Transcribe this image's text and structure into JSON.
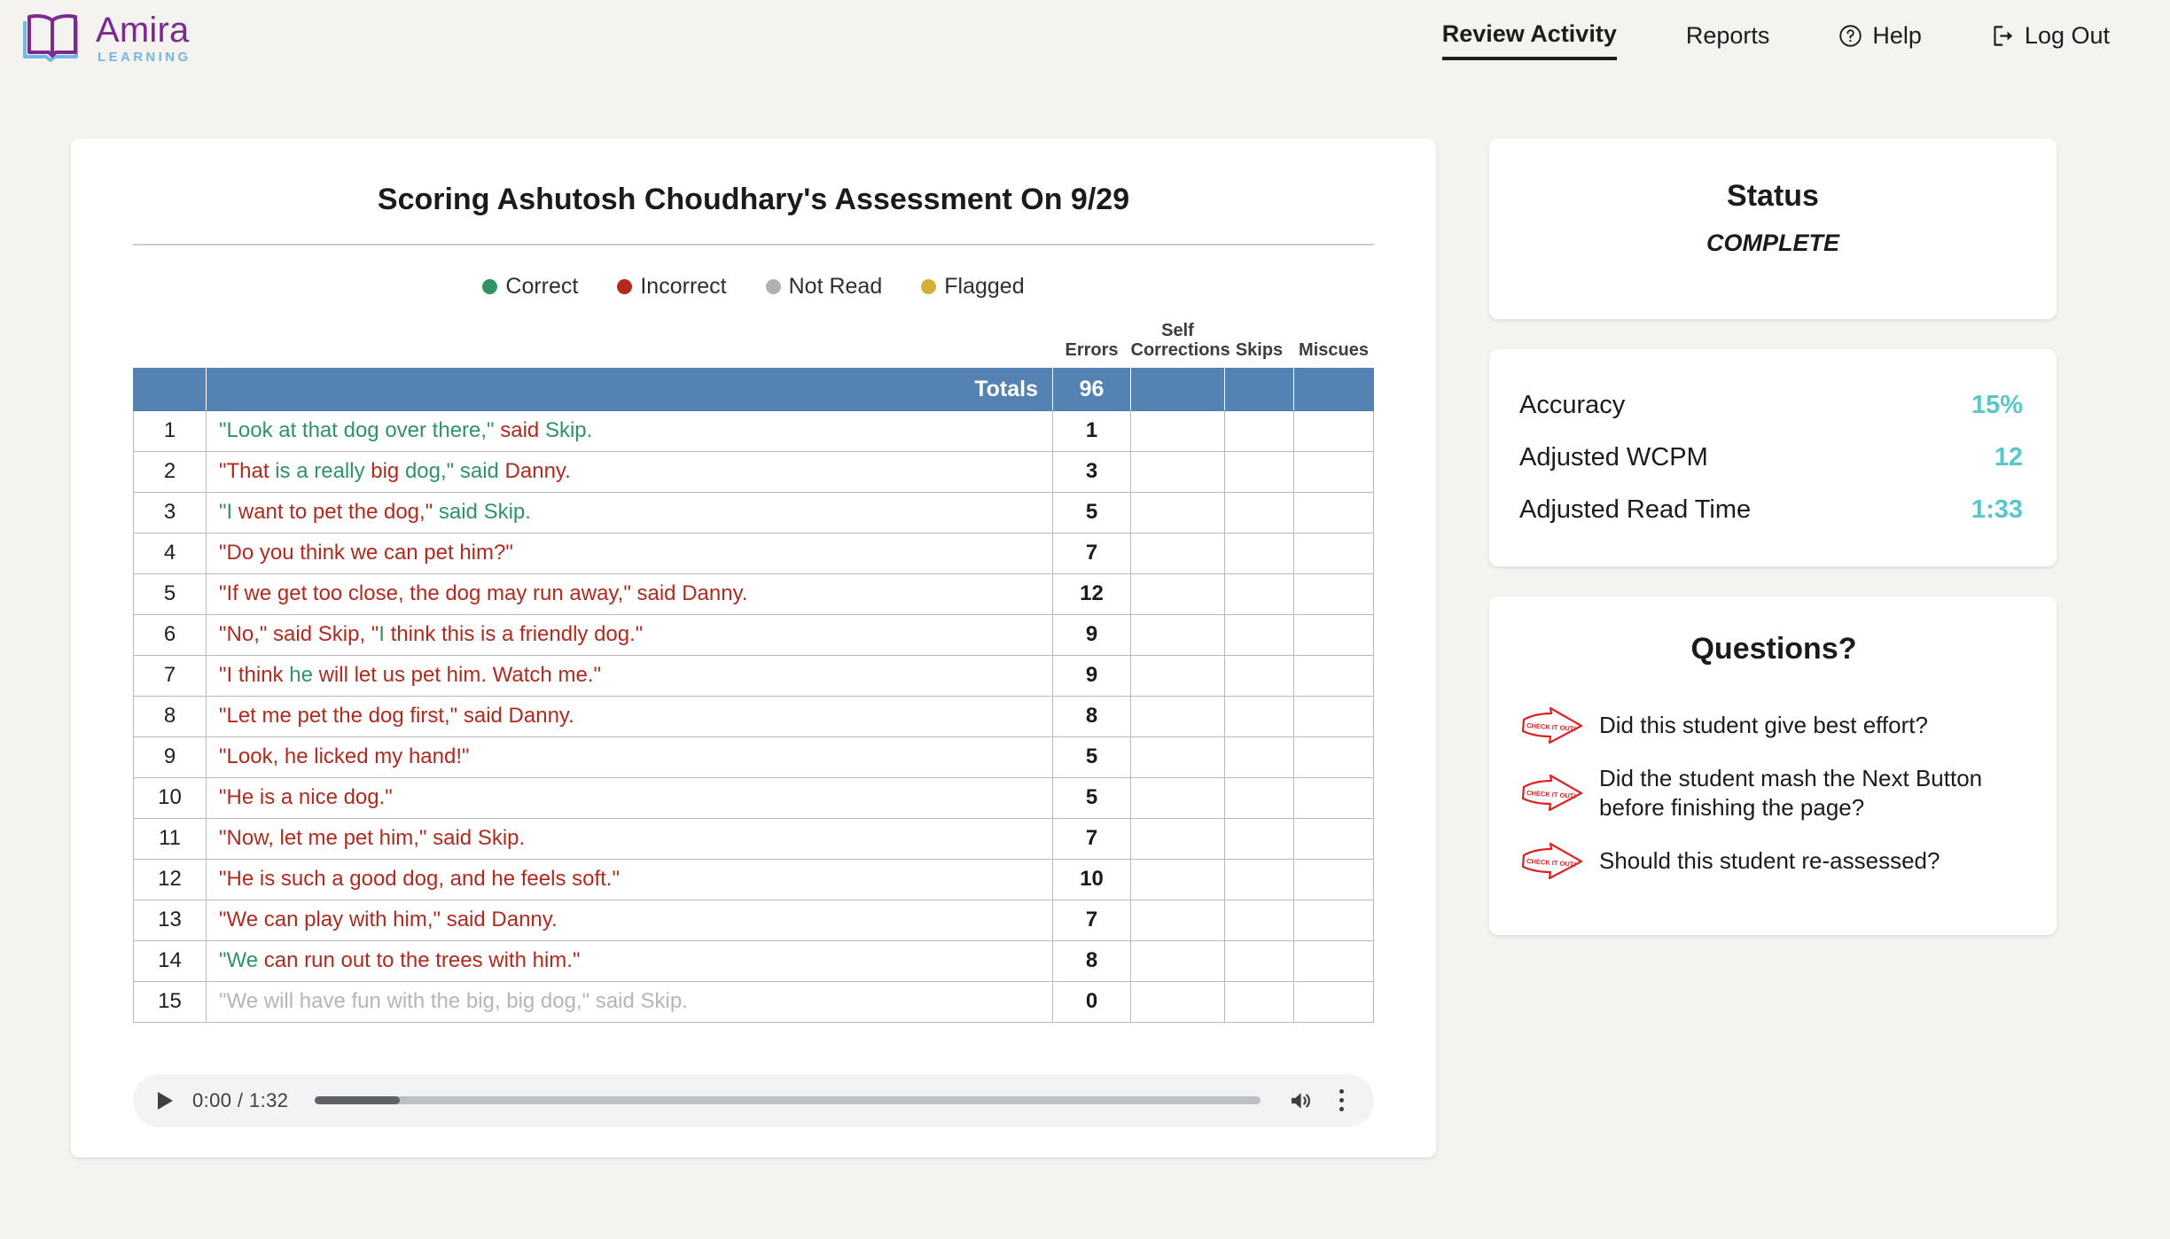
{
  "brand": {
    "name": "Amira",
    "sub": "LEARNING",
    "logo_icon": "open-book-icon"
  },
  "nav": {
    "items": [
      {
        "label": "Review Activity",
        "icon": null,
        "active": true
      },
      {
        "label": "Reports",
        "icon": null,
        "active": false
      },
      {
        "label": "Help",
        "icon": "question-circle-icon",
        "active": false
      },
      {
        "label": "Log Out",
        "icon": "sign-out-icon",
        "active": false
      }
    ]
  },
  "main": {
    "title": "Scoring Ashutosh Choudhary's Assessment On 9/29",
    "legend": [
      {
        "label": "Correct",
        "color": "#2e9464"
      },
      {
        "label": "Incorrect",
        "color": "#b22a1e"
      },
      {
        "label": "Not Read",
        "color": "#b0b0b0"
      },
      {
        "label": "Flagged",
        "color": "#d4af37"
      }
    ],
    "table": {
      "headers": {
        "num": "",
        "text": "",
        "errors": "Errors",
        "self_corrections": "Self Corrections",
        "skips": "Skips",
        "miscues": "Miscues"
      },
      "totals": {
        "label": "Totals",
        "errors": "96",
        "self_corrections": "",
        "skips": "",
        "miscues": ""
      },
      "rows": [
        {
          "num": "1",
          "errors": "1",
          "self_corrections": "",
          "skips": "",
          "miscues": "",
          "segments": [
            {
              "t": "\"Look at that dog over there,\" ",
              "s": "correct"
            },
            {
              "t": "said",
              "s": "incorrect"
            },
            {
              "t": " Skip.",
              "s": "correct"
            }
          ]
        },
        {
          "num": "2",
          "errors": "3",
          "self_corrections": "",
          "skips": "",
          "miscues": "",
          "segments": [
            {
              "t": "\"That",
              "s": "incorrect"
            },
            {
              "t": " is a really ",
              "s": "correct"
            },
            {
              "t": "big",
              "s": "incorrect"
            },
            {
              "t": " dog,\" said ",
              "s": "correct"
            },
            {
              "t": "Danny.",
              "s": "incorrect"
            }
          ]
        },
        {
          "num": "3",
          "errors": "5",
          "self_corrections": "",
          "skips": "",
          "miscues": "",
          "segments": [
            {
              "t": "\"I",
              "s": "correct"
            },
            {
              "t": " want to pet the dog,\" ",
              "s": "incorrect"
            },
            {
              "t": "said Skip.",
              "s": "correct"
            }
          ]
        },
        {
          "num": "4",
          "errors": "7",
          "self_corrections": "",
          "skips": "",
          "miscues": "",
          "segments": [
            {
              "t": "\"Do you think we can pet him?\"",
              "s": "incorrect"
            }
          ]
        },
        {
          "num": "5",
          "errors": "12",
          "self_corrections": "",
          "skips": "",
          "miscues": "",
          "segments": [
            {
              "t": "\"If we get too close, the dog may run away,\" said Danny.",
              "s": "incorrect"
            }
          ]
        },
        {
          "num": "6",
          "errors": "9",
          "self_corrections": "",
          "skips": "",
          "miscues": "",
          "segments": [
            {
              "t": "\"No,\" said Skip, \"",
              "s": "incorrect"
            },
            {
              "t": "I",
              "s": "correct"
            },
            {
              "t": " think this is a friendly dog.\"",
              "s": "incorrect"
            }
          ]
        },
        {
          "num": "7",
          "errors": "9",
          "self_corrections": "",
          "skips": "",
          "miscues": "",
          "segments": [
            {
              "t": "\"I think ",
              "s": "incorrect"
            },
            {
              "t": "he",
              "s": "correct"
            },
            {
              "t": " will let us pet him. Watch me.\"",
              "s": "incorrect"
            }
          ]
        },
        {
          "num": "8",
          "errors": "8",
          "self_corrections": "",
          "skips": "",
          "miscues": "",
          "segments": [
            {
              "t": "\"Let me pet the dog first,\" said Danny.",
              "s": "incorrect"
            }
          ]
        },
        {
          "num": "9",
          "errors": "5",
          "self_corrections": "",
          "skips": "",
          "miscues": "",
          "segments": [
            {
              "t": "\"Look, he licked my hand!\"",
              "s": "incorrect"
            }
          ]
        },
        {
          "num": "10",
          "errors": "5",
          "self_corrections": "",
          "skips": "",
          "miscues": "",
          "segments": [
            {
              "t": "\"He is a nice dog.\"",
              "s": "incorrect"
            }
          ]
        },
        {
          "num": "11",
          "errors": "7",
          "self_corrections": "",
          "skips": "",
          "miscues": "",
          "segments": [
            {
              "t": "\"Now, let me pet him,\" said Skip.",
              "s": "incorrect"
            }
          ]
        },
        {
          "num": "12",
          "errors": "10",
          "self_corrections": "",
          "skips": "",
          "miscues": "",
          "segments": [
            {
              "t": "\"He is such a good dog, and he feels soft.\"",
              "s": "incorrect"
            }
          ]
        },
        {
          "num": "13",
          "errors": "7",
          "self_corrections": "",
          "skips": "",
          "miscues": "",
          "segments": [
            {
              "t": "\"We can play with him,\" said Danny.",
              "s": "incorrect"
            }
          ]
        },
        {
          "num": "14",
          "errors": "8",
          "self_corrections": "",
          "skips": "",
          "miscues": "",
          "segments": [
            {
              "t": "\"We",
              "s": "correct"
            },
            {
              "t": " can run out to the trees with him.\"",
              "s": "incorrect"
            }
          ]
        },
        {
          "num": "15",
          "errors": "0",
          "self_corrections": "",
          "skips": "",
          "miscues": "",
          "segments": [
            {
              "t": "\"We will have fun with the big, big dog,\" said Skip.",
              "s": "notread"
            }
          ]
        }
      ]
    },
    "audio": {
      "play_icon": "play-icon",
      "time": "0:00 / 1:32",
      "progress_percent": 9,
      "volume_icon": "volume-icon",
      "menu_icon": "kebab-menu-icon"
    }
  },
  "sidebar": {
    "status": {
      "title": "Status",
      "value": "COMPLETE"
    },
    "metrics": [
      {
        "label": "Accuracy",
        "value": "15%"
      },
      {
        "label": "Adjusted WCPM",
        "value": "12"
      },
      {
        "label": "Adjusted Read Time",
        "value": "1:33"
      }
    ],
    "questions": {
      "title": "Questions?",
      "items": [
        {
          "icon": "check-it-out-arrow-icon",
          "text": "Did this student give best effort?"
        },
        {
          "icon": "check-it-out-arrow-icon",
          "text": "Did the student mash the Next Button before finishing the page?"
        },
        {
          "icon": "check-it-out-arrow-icon",
          "text": "Should this student re-assessed?"
        }
      ]
    }
  },
  "colors": {
    "page_bg": "#f5f3ef",
    "table_header_blue": "#5483b3",
    "accent_teal": "#58c7c9",
    "brand_purple": "#7b2a8f",
    "brand_blue": "#72b7e6"
  }
}
